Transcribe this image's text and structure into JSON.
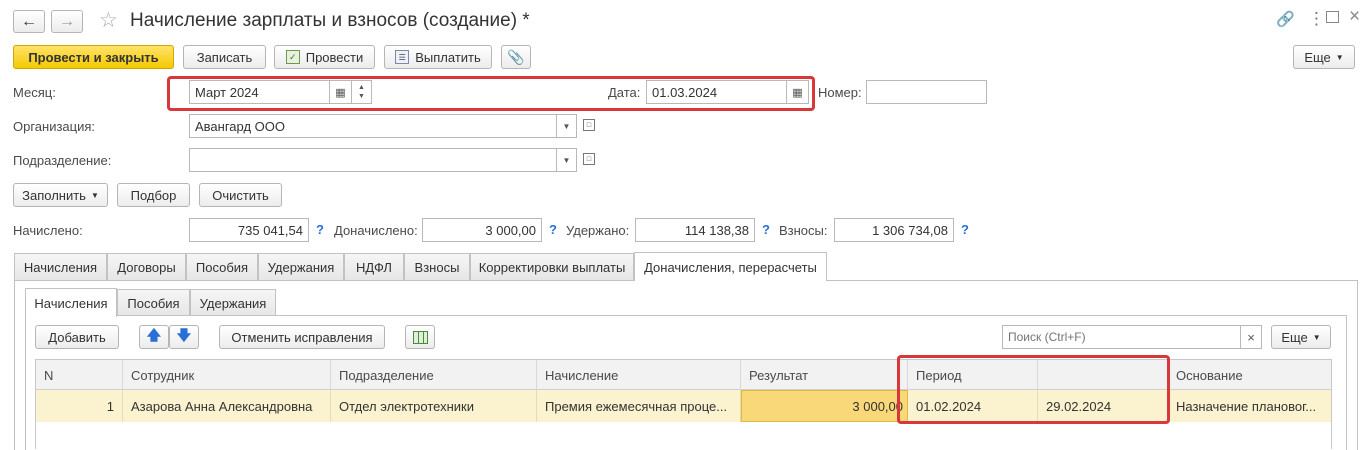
{
  "window": {
    "title": "Начисление зарплаты и взносов (создание) *"
  },
  "toolbar": {
    "post_close": "Провести и закрыть",
    "save": "Записать",
    "post": "Провести",
    "pay": "Выплатить",
    "more": "Еще"
  },
  "header": {
    "month_label": "Месяц:",
    "month_value": "Март 2024",
    "date_label": "Дата:",
    "date_value": "01.03.2024",
    "number_label": "Номер:",
    "number_value": "",
    "org_label": "Организация:",
    "org_value": "Авангард ООО",
    "dept_label": "Подразделение:",
    "dept_value": ""
  },
  "actions": {
    "fill": "Заполнить",
    "select": "Подбор",
    "clear": "Очистить"
  },
  "totals": {
    "accrued_label": "Начислено:",
    "accrued_value": "735 041,54",
    "extra_label": "Доначислено:",
    "extra_value": "3 000,00",
    "withheld_label": "Удержано:",
    "withheld_value": "114 138,38",
    "contrib_label": "Взносы:",
    "contrib_value": "1 306 734,08",
    "help": "?"
  },
  "tabs": [
    "Начисления",
    "Договоры",
    "Пособия",
    "Удержания",
    "НДФЛ",
    "Взносы",
    "Корректировки выплаты",
    "Доначисления, перерасчеты"
  ],
  "subtabs": [
    "Начисления",
    "Пособия",
    "Удержания"
  ],
  "table_toolbar": {
    "add": "Добавить",
    "cancel_fix": "Отменить исправления",
    "search_placeholder": "Поиск (Ctrl+F)",
    "clear_search": "×",
    "more": "Еще"
  },
  "table": {
    "columns": [
      "N",
      "Сотрудник",
      "Подразделение",
      "Начисление",
      "Результат",
      "Период",
      "",
      "Основание"
    ],
    "rows": [
      {
        "n": "1",
        "employee": "Азарова Анна Александровна",
        "department": "Отдел электротехники",
        "accrual": "Премия ежемесячная проце...",
        "result": "3 000,00",
        "period_start": "01.02.2024",
        "period_end": "29.02.2024",
        "basis": "Назначение плановог..."
      }
    ]
  },
  "colors": {
    "highlight": "#d9383a",
    "primary_button": "#f5c900",
    "row_selected": "#fbf3cf"
  }
}
